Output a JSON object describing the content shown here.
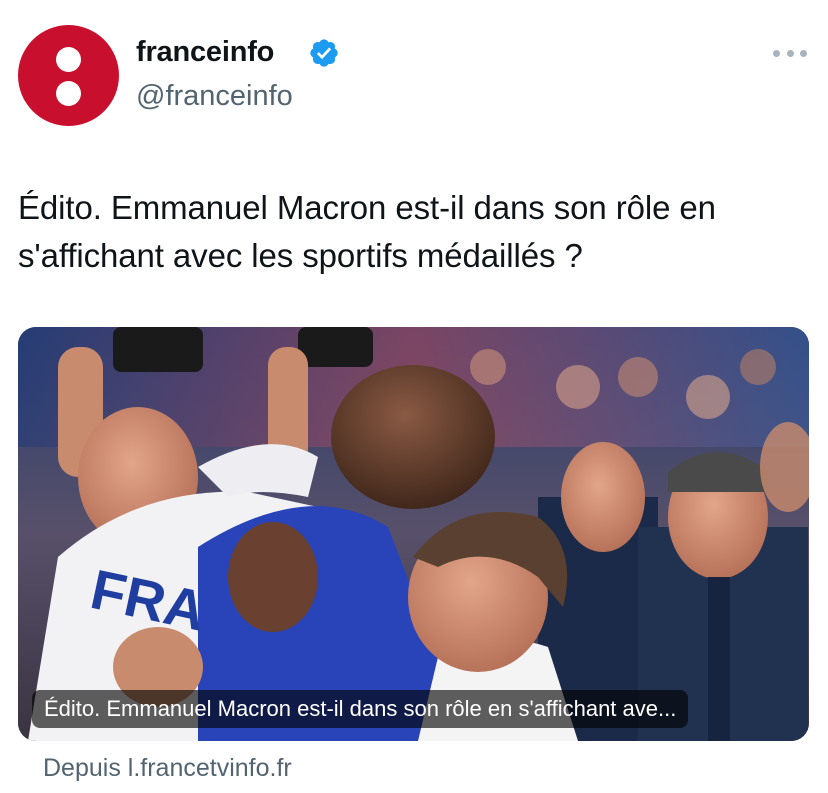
{
  "author": {
    "display_name": "franceinfo",
    "handle": "@franceinfo",
    "verified_icon": "verified-badge-icon",
    "avatar_color": "#c8102e",
    "verified_color": "#1d9bf0"
  },
  "tweet": {
    "text": "Édito. Emmanuel Macron est-il dans son rôle en s'affichant avec les sportifs médaillés ?"
  },
  "link_card": {
    "caption": "Édito. Emmanuel Macron est-il dans son rôle en s'affichant ave...",
    "source": "Depuis l.francetvinfo.fr",
    "jersey_text": "FRA"
  },
  "more_icon": "more-options-icon"
}
